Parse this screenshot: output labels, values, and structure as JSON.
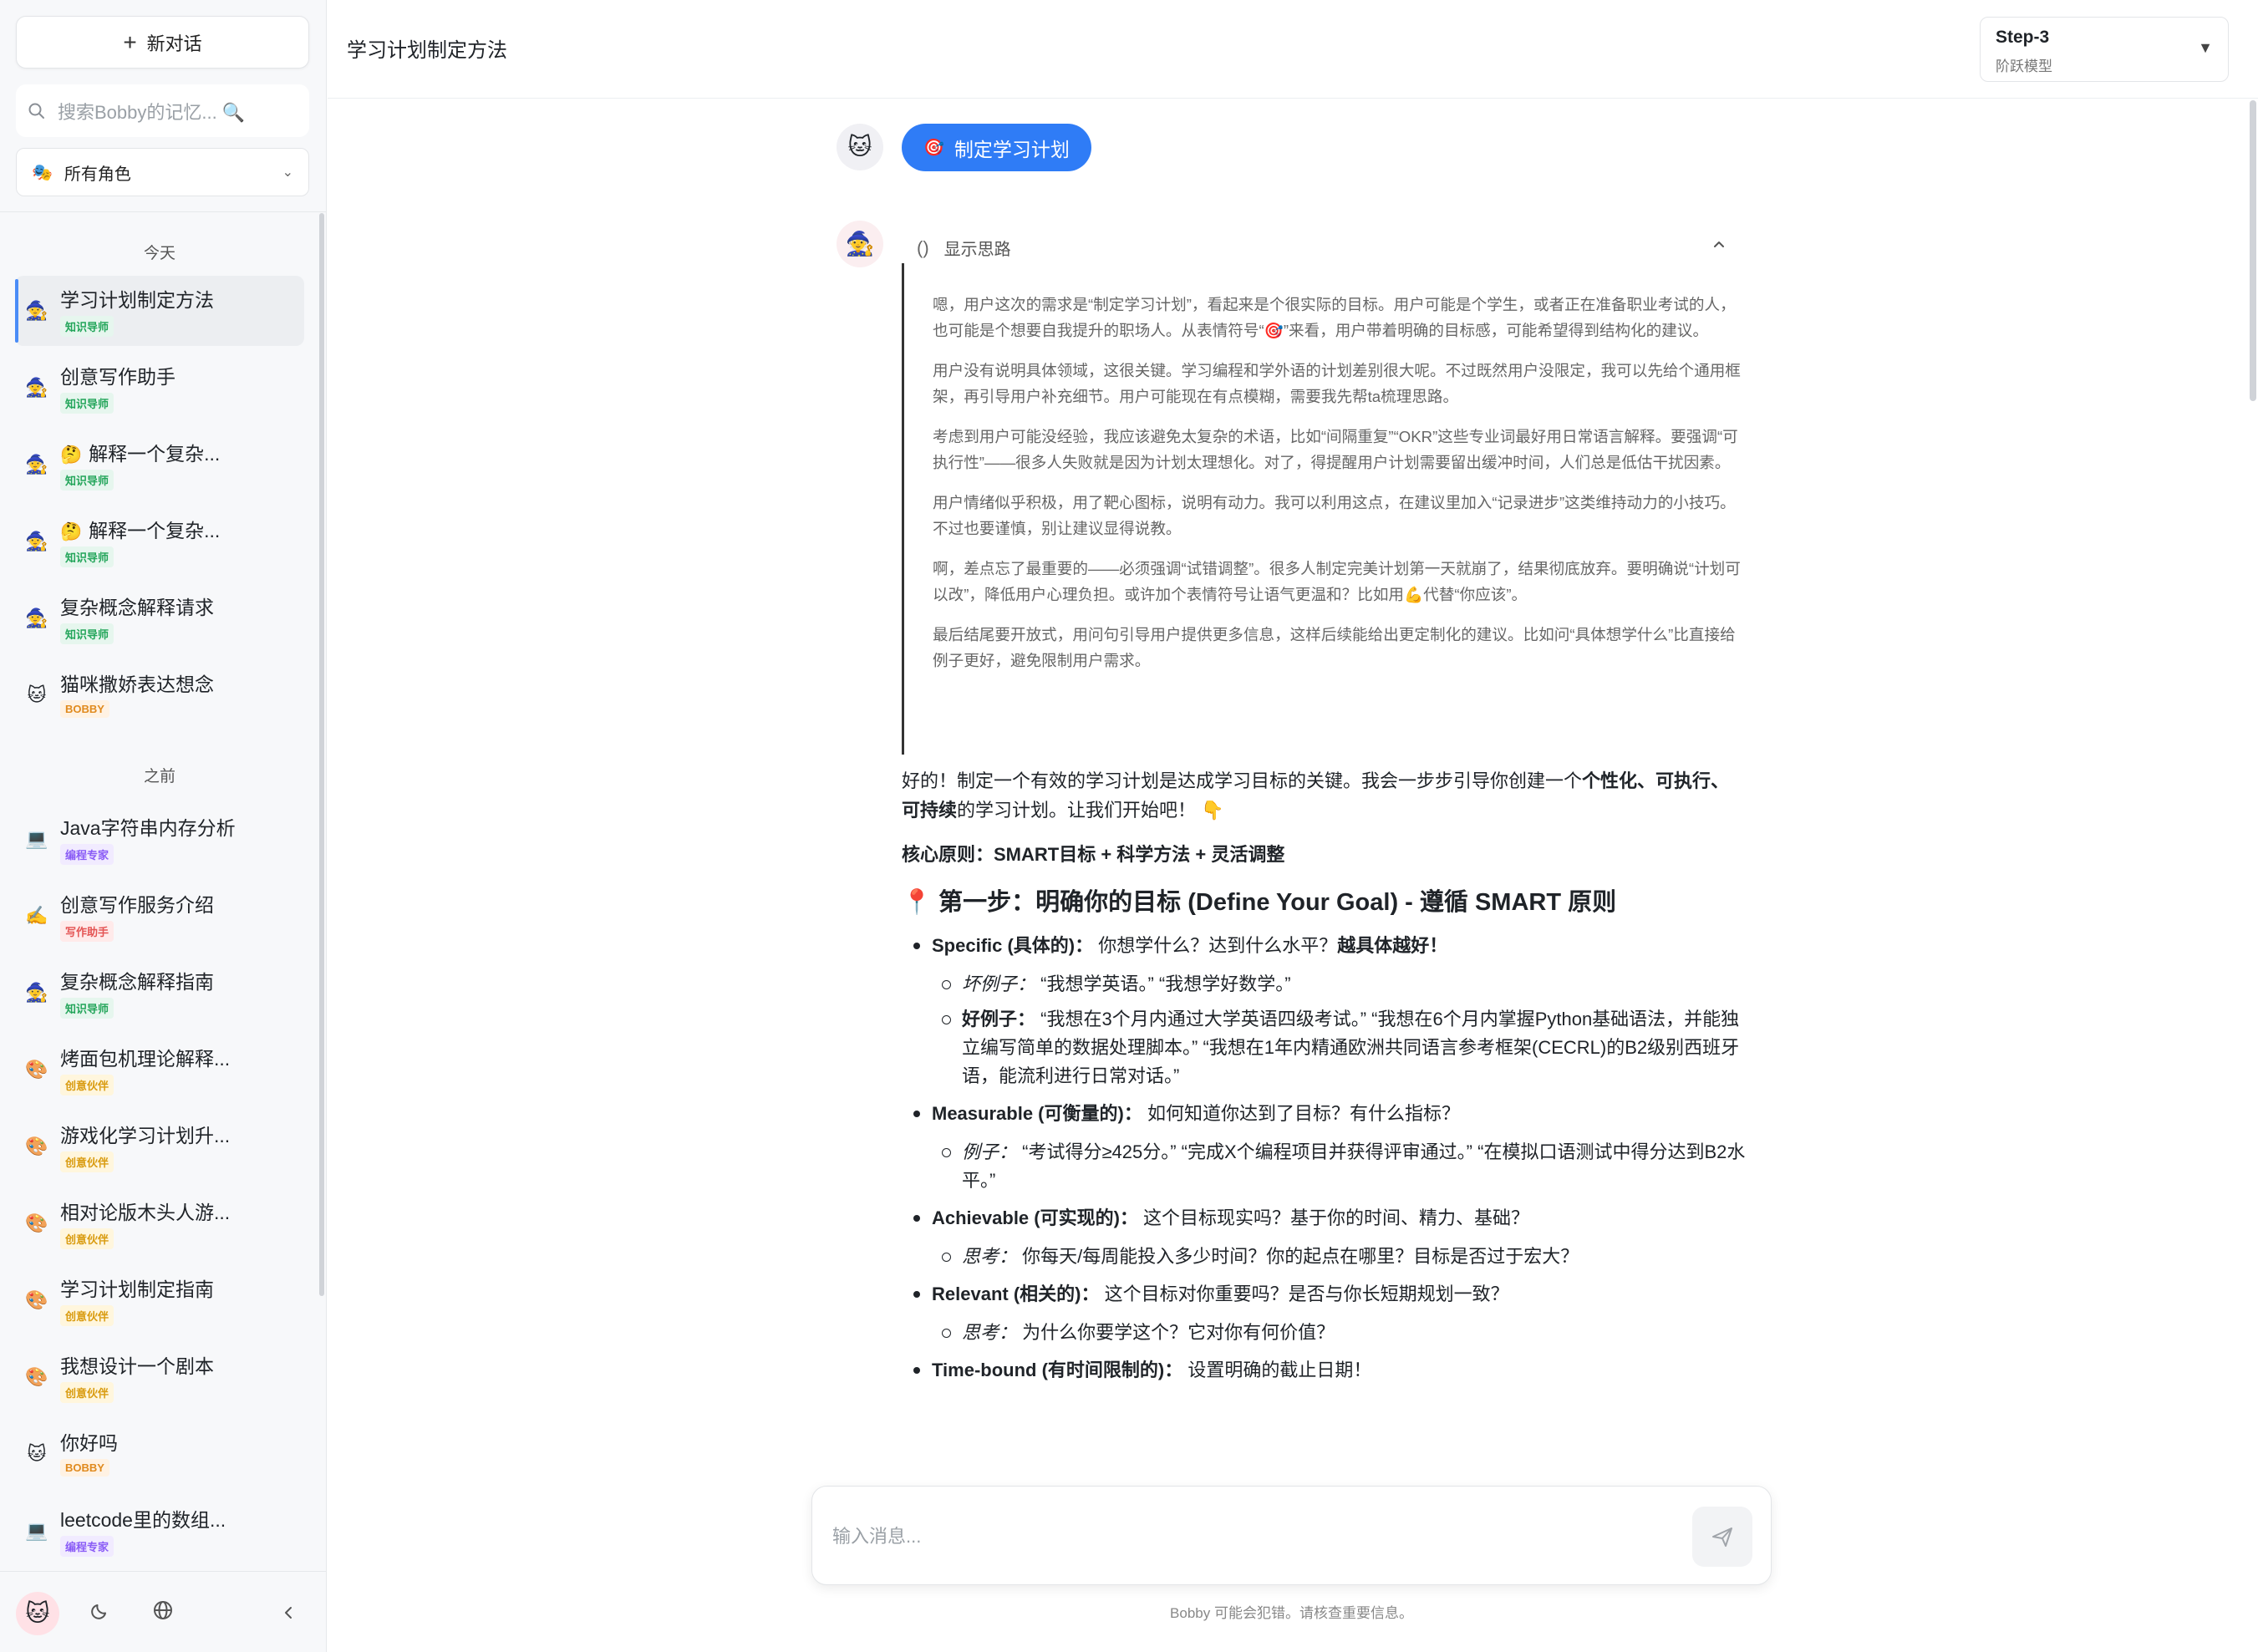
{
  "sidebar": {
    "new_chat_label": "新对话",
    "search_placeholder": "搜索Bobby的记忆... 🔍",
    "role_filter_label": "所有角色",
    "sections": {
      "today": "今天",
      "earlier": "之前"
    },
    "today_items": [
      {
        "title": "学习计划制定方法",
        "badge": "知识导师",
        "avatar": "🧙",
        "active": true
      },
      {
        "title": "创意写作助手",
        "badge": "知识导师",
        "avatar": "🧙"
      },
      {
        "title": "解释一个复杂...",
        "emoji": "🤔",
        "badge": "知识导师",
        "avatar": "🧙"
      },
      {
        "title": "解释一个复杂...",
        "emoji": "🤔",
        "badge": "知识导师",
        "avatar": "🧙"
      },
      {
        "title": "复杂概念解释请求",
        "badge": "知识导师",
        "avatar": "🧙"
      },
      {
        "title": "猫咪撒娇表达想念",
        "badge": "BOBBY",
        "avatar": "🐱"
      }
    ],
    "earlier_items": [
      {
        "title": "Java字符串内存分析",
        "badge": "编程专家",
        "avatar": "💻"
      },
      {
        "title": "创意写作服务介绍",
        "badge": "写作助手",
        "avatar": "✍️"
      },
      {
        "title": "复杂概念解释指南",
        "badge": "知识导师",
        "avatar": "🧙"
      },
      {
        "title": "烤面包机理论解释...",
        "badge": "创意伙伴",
        "avatar": "🎨"
      },
      {
        "title": "游戏化学习计划升...",
        "badge": "创意伙伴",
        "avatar": "🎨"
      },
      {
        "title": "相对论版木头人游...",
        "badge": "创意伙伴",
        "avatar": "🎨"
      },
      {
        "title": "学习计划制定指南",
        "badge": "创意伙伴",
        "avatar": "🎨"
      },
      {
        "title": "我想设计一个剧本",
        "badge": "创意伙伴",
        "avatar": "🎨"
      },
      {
        "title": "你好吗",
        "badge": "BOBBY",
        "avatar": "🐱"
      },
      {
        "title": "leetcode里的数组...",
        "badge": "编程专家",
        "avatar": "💻"
      }
    ],
    "footer_icons": [
      "cat-avatar-icon",
      "moon-icon",
      "globe-icon",
      "chevron-left-icon"
    ]
  },
  "header": {
    "title": "学习计划制定方法",
    "model_name": "Step-3",
    "model_sub": "阶跃模型"
  },
  "chat": {
    "user_message": "制定学习计划",
    "user_emoji": "🎯",
    "thought_toggle": "显示思路",
    "thoughts": [
      "嗯，用户这次的需求是“制定学习计划”，看起来是个很实际的目标。用户可能是个学生，或者正在准备职业考试的人，也可能是个想要自我提升的职场人。从表情符号“🎯”来看，用户带着明确的目标感，可能希望得到结构化的建议。",
      "用户没有说明具体领域，这很关键。学习编程和学外语的计划差别很大呢。不过既然用户没限定，我可以先给个通用框架，再引导用户补充细节。用户可能现在有点模糊，需要我先帮ta梳理思路。",
      "考虑到用户可能没经验，我应该避免太复杂的术语，比如“间隔重复”“OKR”这些专业词最好用日常语言解释。要强调“可执行性”——很多人失败就是因为计划太理想化。对了，得提醒用户计划需要留出缓冲时间，人们总是低估干扰因素。",
      "用户情绪似乎积极，用了靶心图标，说明有动力。我可以利用这点，在建议里加入“记录进步”这类维持动力的小技巧。不过也要谨慎，别让建议显得说教。",
      "啊，差点忘了最重要的——必须强调“试错调整”。很多人制定完美计划第一天就崩了，结果彻底放弃。要明确说“计划可以改”，降低用户心理负担。或许加个表情符号让语气更温和？比如用💪代替“你应该”。",
      "最后结尾要开放式，用问句引导用户提供更多信息，这样后续能给出更定制化的建议。比如问“具体想学什么”比直接给例子更好，避免限制用户需求。"
    ],
    "answer": {
      "intro_a": "好的！制定一个有效的学习计划是达成学习目标的关键。我会一步步引导你创建一个",
      "intro_bold": "个性化、可执行、可持续",
      "intro_b": "的学习计划。让我们开始吧！ 👇",
      "core_principle": "核心原则：SMART目标 + 科学方法 + 灵活调整",
      "step1_heading": "📍 第一步：明确你的目标 (Define Your Goal) - 遵循 SMART 原则",
      "items": [
        {
          "label": "Specific (具体的)：",
          "text": " 你想学什么？达到什么水平？",
          "bold_tail": "越具体越好！",
          "subs": [
            {
              "label": "坏例子：",
              "text": " “我想学英语。” “我想学好数学。”"
            },
            {
              "label": "好例子：",
              "text": " “我想在3个月内通过大学英语四级考试。” “我想在6个月内掌握Python基础语法，并能独立编写简单的数据处理脚本。” “我想在1年内精通欧洲共同语言参考框架(CECRL)的B2级别西班牙语，能流利进行日常对话。”"
            }
          ]
        },
        {
          "label": "Measurable (可衡量的)：",
          "text": " 如何知道你达到了目标？有什么指标？",
          "subs": [
            {
              "label": "例子：",
              "text": " “考试得分≥425分。” “完成X个编程项目并获得评审通过。” “在模拟口语测试中得分达到B2水平。”"
            }
          ]
        },
        {
          "label": "Achievable (可实现的)：",
          "text": " 这个目标现实吗？基于你的时间、精力、基础？",
          "subs": [
            {
              "label": "思考：",
              "text": " 你每天/每周能投入多少时间？你的起点在哪里？目标是否过于宏大？"
            }
          ]
        },
        {
          "label": "Relevant (相关的)：",
          "text": " 这个目标对你重要吗？是否与你长短期规划一致？",
          "subs": [
            {
              "label": "思考：",
              "text": " 为什么你要学这个？它对你有何价值？"
            }
          ]
        },
        {
          "label": "Time-bound (有时间限制的)：",
          "text": " 设置明确的截止日期！",
          "subs": []
        }
      ]
    }
  },
  "composer": {
    "placeholder": "输入消息...",
    "disclaimer": "Bobby 可能会犯错。请核查重要信息。"
  }
}
